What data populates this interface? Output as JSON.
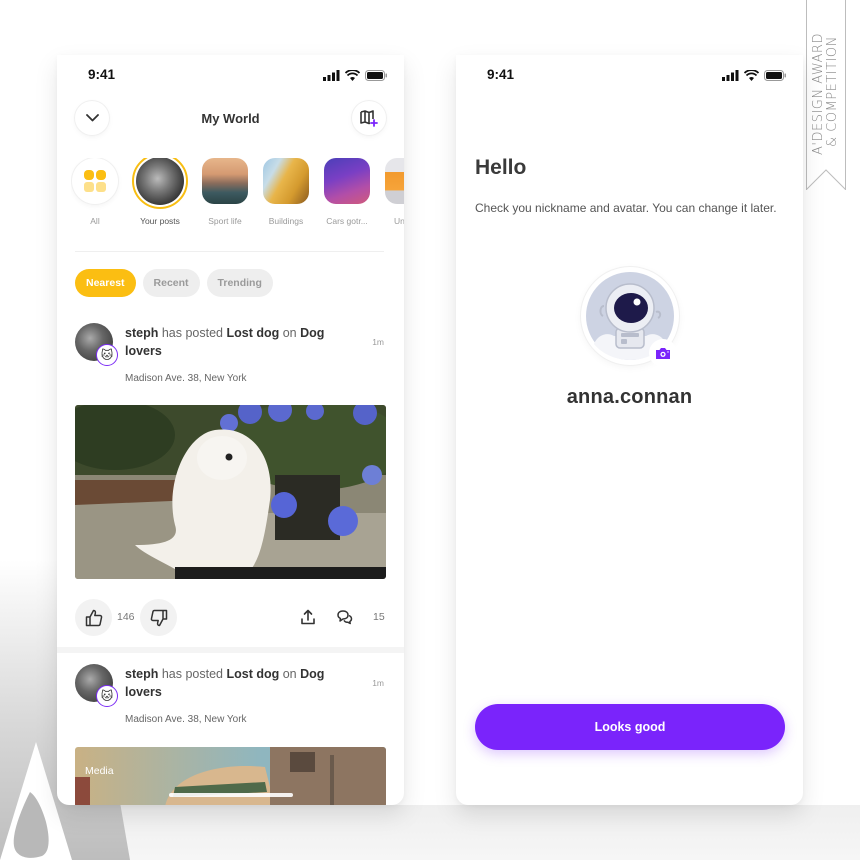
{
  "award": {
    "line1": "A'DESIGN AWARD",
    "line2": "& COMPETITION"
  },
  "left_screen": {
    "status_bar": {
      "time": "9:41"
    },
    "header": {
      "title": "My World",
      "collapse_icon": "chevron-down-icon",
      "add_map_icon": "map-add-icon"
    },
    "stories": [
      {
        "label": "All"
      },
      {
        "label": "Your posts"
      },
      {
        "label": "Sport life"
      },
      {
        "label": "Buildings"
      },
      {
        "label": "Cars gotr..."
      },
      {
        "label": "Underg"
      }
    ],
    "filters": [
      {
        "label": "Nearest",
        "active": true
      },
      {
        "label": "Recent",
        "active": false
      },
      {
        "label": "Trending",
        "active": false
      }
    ],
    "posts": [
      {
        "user": "steph",
        "verb": "has posted",
        "title": "Lost dog",
        "on": "on",
        "group": "Dog lovers",
        "time": "1m",
        "location": "Madison Ave. 38, New York",
        "badge": "🐱",
        "likes": "146",
        "comments": "15"
      },
      {
        "user": "steph",
        "verb": "has posted",
        "title": "Lost dog",
        "on": "on",
        "group": "Dog lovers",
        "time": "1m",
        "location": "Madison Ave. 38, New York",
        "badge": "🐱",
        "media_label": "Media"
      }
    ]
  },
  "right_screen": {
    "status_bar": {
      "time": "9:41"
    },
    "title": "Hello",
    "description": "Check you nickname and avatar. You can change it later.",
    "nickname": "anna.connan",
    "cta_label": "Looks good"
  },
  "colors": {
    "accent_yellow": "#fbbe12",
    "accent_purple": "#7a24fb"
  }
}
